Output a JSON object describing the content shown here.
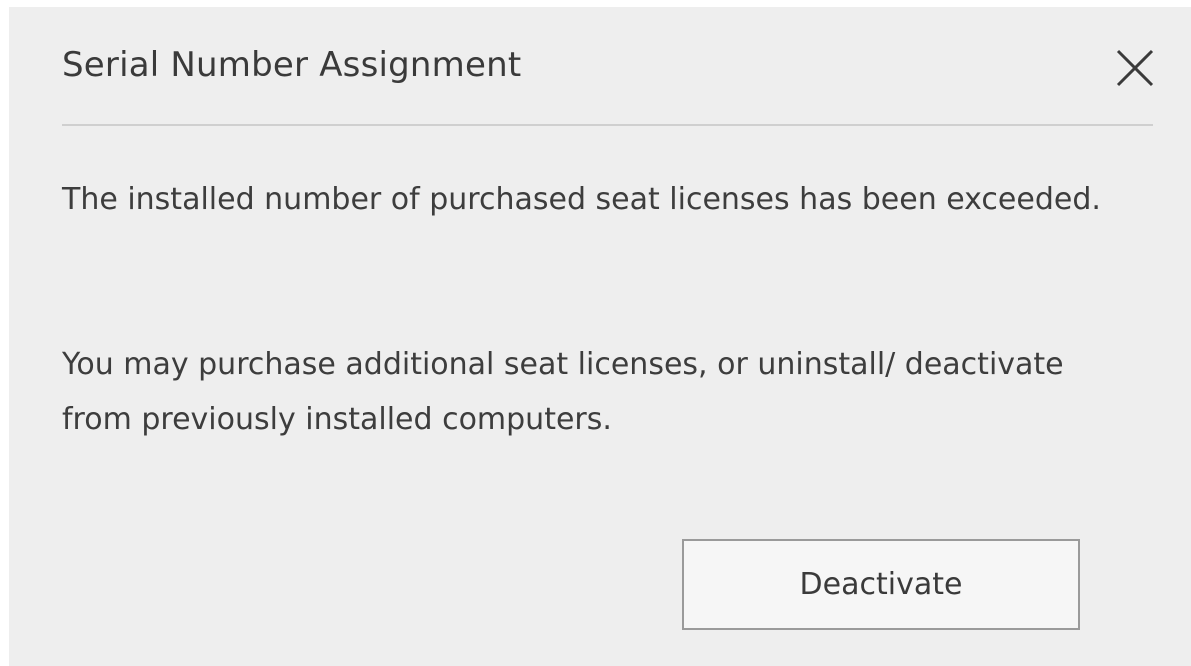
{
  "dialog": {
    "title": "Serial Number Assignment",
    "close_icon": "close-icon",
    "messages": [
      "The installed number of purchased seat licenses has been exceeded.",
      "You may purchase additional seat licenses, or uninstall/ deactivate from previously installed computers."
    ],
    "primary_button_label": "Deactivate"
  },
  "colors": {
    "dialog_background": "#eeeeee",
    "text": "#3d3d3d",
    "divider": "#cfcfcf",
    "button_border": "#9a9a9a"
  }
}
